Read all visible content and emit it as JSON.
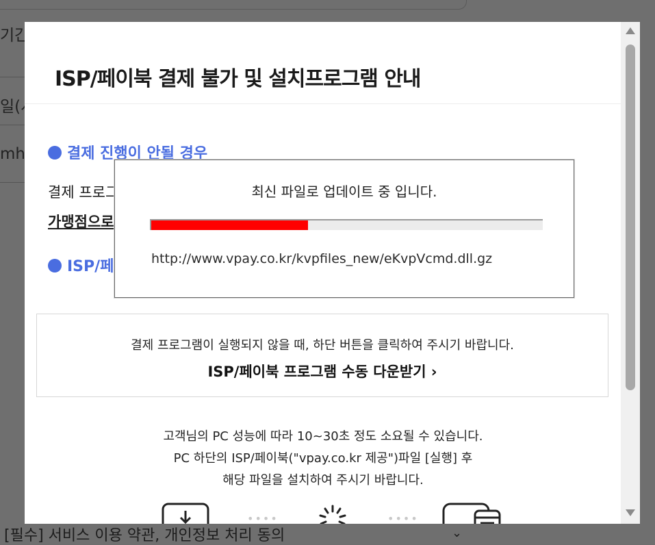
{
  "background": {
    "fragment_1": "기간",
    "fragment_2": "일(시",
    "fragment_3": "mh",
    "bottom_text": "[필수] 서비스 이용 약관, 개인정보 처리 동의"
  },
  "modal": {
    "title": "ISP/페이북 결제 불가 및 설치프로그램 안내",
    "section1_heading": "결제 진행이 안될 경우",
    "section1_text": "결제 프로그",
    "section1_link": "가맹점으로",
    "section2_heading": "ISP/페",
    "notice_text": "결제 프로그램이 실행되지 않을 때, 하단 버튼을 클릭하여 주시기 바랍니다.",
    "download_label": "ISP/페이북 프로그램 수동 다운받기 ›",
    "info_lines": [
      "고객님의 PC 성능에 따라 10~30초 정도 소요될 수 있습니다.",
      "PC 하단의 ISP/페이북(\"vpay.co.kr 제공\")파일 [실행] 후",
      "해당 파일을 설치하여 주시기 바랍니다."
    ],
    "steps": [
      "download-icon",
      "loading-spinner-icon",
      "window-install-icon"
    ]
  },
  "popup": {
    "message": "최신 파일로 업데이트 중 입니다.",
    "progress_percent": 40,
    "progress_color": "#ff0000",
    "url": "http://www.vpay.co.kr/kvpfiles_new/eKvpVcmd.dll.gz"
  },
  "colors": {
    "accent": "#4a6de0",
    "overlay": "#6f6f6f"
  }
}
